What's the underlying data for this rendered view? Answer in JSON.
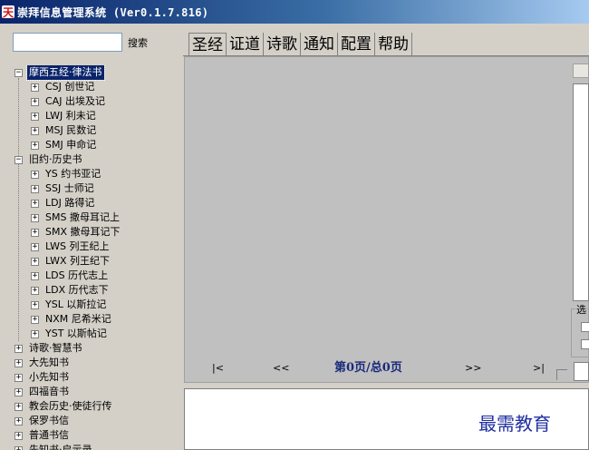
{
  "window": {
    "title": "崇拜信息管理系统 (Ver0.1.7.816)",
    "icon_glyph": "天"
  },
  "search": {
    "value": "",
    "placeholder": "",
    "button_label": "搜索"
  },
  "tree": [
    {
      "label": "摩西五经·律法书",
      "expanded": true,
      "selected": true,
      "children": [
        "CSJ 创世记",
        "CAJ 出埃及记",
        "LWJ 利未记",
        "MSJ 民数记",
        "SMJ 申命记"
      ]
    },
    {
      "label": "旧约·历史书",
      "expanded": true,
      "selected": false,
      "children": [
        "YS 约书亚记",
        "SSJ 士师记",
        "LDJ 路得记",
        "SMS 撒母耳记上",
        "SMX 撒母耳记下",
        "LWS 列王纪上",
        "LWX 列王纪下",
        "LDS 历代志上",
        "LDX 历代志下",
        "YSL 以斯拉记",
        "NXM 尼希米记",
        "YST 以斯帖记"
      ]
    },
    {
      "label": "诗歌·智慧书",
      "expanded": false,
      "selected": false,
      "children": []
    },
    {
      "label": "大先知书",
      "expanded": false,
      "selected": false,
      "children": []
    },
    {
      "label": "小先知书",
      "expanded": false,
      "selected": false,
      "children": []
    },
    {
      "label": "四福音书",
      "expanded": false,
      "selected": false,
      "children": []
    },
    {
      "label": "教会历史·使徒行传",
      "expanded": false,
      "selected": false,
      "children": []
    },
    {
      "label": "保罗书信",
      "expanded": false,
      "selected": false,
      "children": []
    },
    {
      "label": "普通书信",
      "expanded": false,
      "selected": false,
      "children": []
    },
    {
      "label": "先知书·启示录",
      "expanded": false,
      "selected": false,
      "children": []
    }
  ],
  "tabs": [
    {
      "label": "圣经",
      "active": true
    },
    {
      "label": "证道",
      "active": false
    },
    {
      "label": "诗歌",
      "active": false
    },
    {
      "label": "通知",
      "active": false
    },
    {
      "label": "配置",
      "active": false
    },
    {
      "label": "帮助",
      "active": false
    }
  ],
  "side_panel": {
    "group_label": "选"
  },
  "navigation": {
    "first": "|<",
    "prev": "<<",
    "status": "第0页/总0页",
    "next": ">>",
    "last": ">|"
  },
  "watermark": "最需教育",
  "colors": {
    "selection": "#0a246a",
    "status_text": "#1a2a7a",
    "watermark": "#2030a0"
  }
}
